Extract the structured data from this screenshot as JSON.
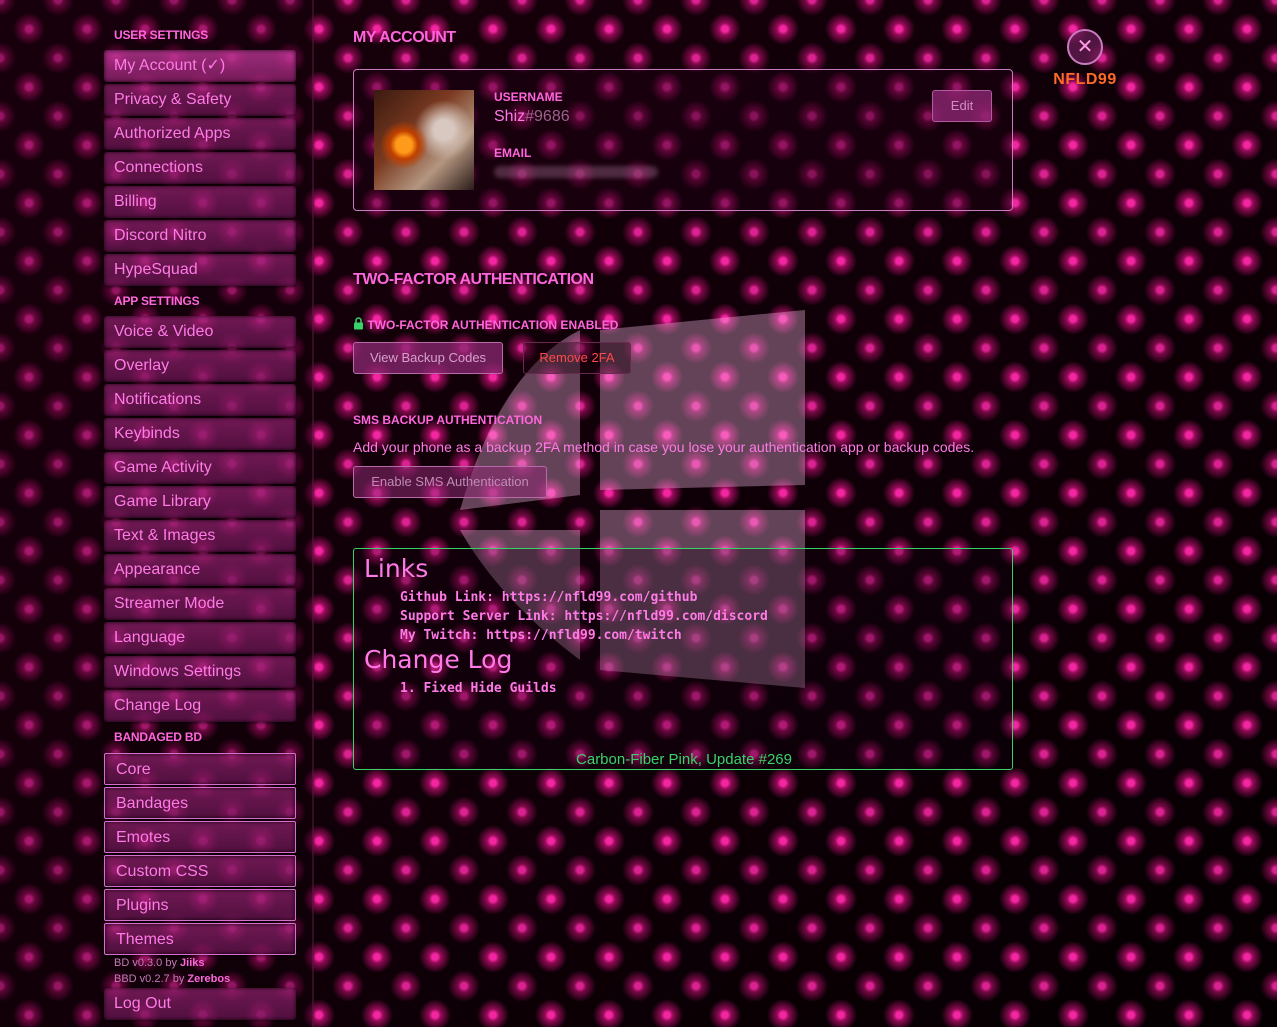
{
  "sidebar": {
    "user_settings_header": "USER SETTINGS",
    "user_items": [
      {
        "label": "My Account (✓)"
      },
      {
        "label": "Privacy & Safety"
      },
      {
        "label": "Authorized Apps"
      },
      {
        "label": "Connections"
      },
      {
        "label": "Billing"
      },
      {
        "label": "Discord Nitro"
      },
      {
        "label": "HypeSquad"
      }
    ],
    "app_settings_header": "APP SETTINGS",
    "app_items": [
      {
        "label": "Voice & Video"
      },
      {
        "label": "Overlay"
      },
      {
        "label": "Notifications"
      },
      {
        "label": "Keybinds"
      },
      {
        "label": "Game Activity"
      },
      {
        "label": "Game Library"
      },
      {
        "label": "Text & Images"
      },
      {
        "label": "Appearance"
      },
      {
        "label": "Streamer Mode"
      },
      {
        "label": "Language"
      },
      {
        "label": "Windows Settings"
      },
      {
        "label": "Change Log"
      }
    ],
    "bd_header": "BANDAGED BD",
    "bd_items": [
      {
        "label": "Core"
      },
      {
        "label": "Bandages"
      },
      {
        "label": "Emotes"
      },
      {
        "label": "Custom CSS"
      },
      {
        "label": "Plugins"
      },
      {
        "label": "Themes"
      }
    ],
    "credits": {
      "bd_version": "BD v0.3.0 by",
      "bd_author": "Jiiks",
      "bbd_version": "BBD v0.2.7 by",
      "bbd_author": "Zerebos"
    },
    "logout": "Log Out"
  },
  "account": {
    "title": "MY ACCOUNT",
    "username_label": "USERNAME",
    "username": "Shiz",
    "discriminator": "#9686",
    "email_label": "EMAIL",
    "edit_button": "Edit"
  },
  "two_factor": {
    "title": "TWO-FACTOR AUTHENTICATION",
    "enabled_label": "TWO-FACTOR AUTHENTICATION ENABLED",
    "view_backup_button": "View Backup Codes",
    "remove_button": "Remove 2FA",
    "sms_label": "SMS BACKUP AUTHENTICATION",
    "sms_desc": "Add your phone as a backup 2FA method in case you lose your authentication app or backup codes.",
    "sms_button": "Enable SMS Authentication"
  },
  "links": {
    "title": "Links",
    "items": [
      {
        "text": "Github Link: https://nfld99.com/github"
      },
      {
        "text": "Support Server Link: https://nfld99.com/discord"
      },
      {
        "text": "My Twitch: https://nfld99.com/twitch"
      }
    ],
    "changelog_title": "Change Log",
    "changelog_items": [
      {
        "text": "1. Fixed Hide Guilds"
      }
    ],
    "footer": "Carbon-Fiber Pink, Update #269"
  },
  "close": {
    "icon": "✕",
    "label": "NFLD99"
  },
  "colors": {
    "accent": "#ff66dd",
    "green": "#39d26a",
    "danger": "#ff4a4a",
    "close_label": "#ff6a2a"
  }
}
